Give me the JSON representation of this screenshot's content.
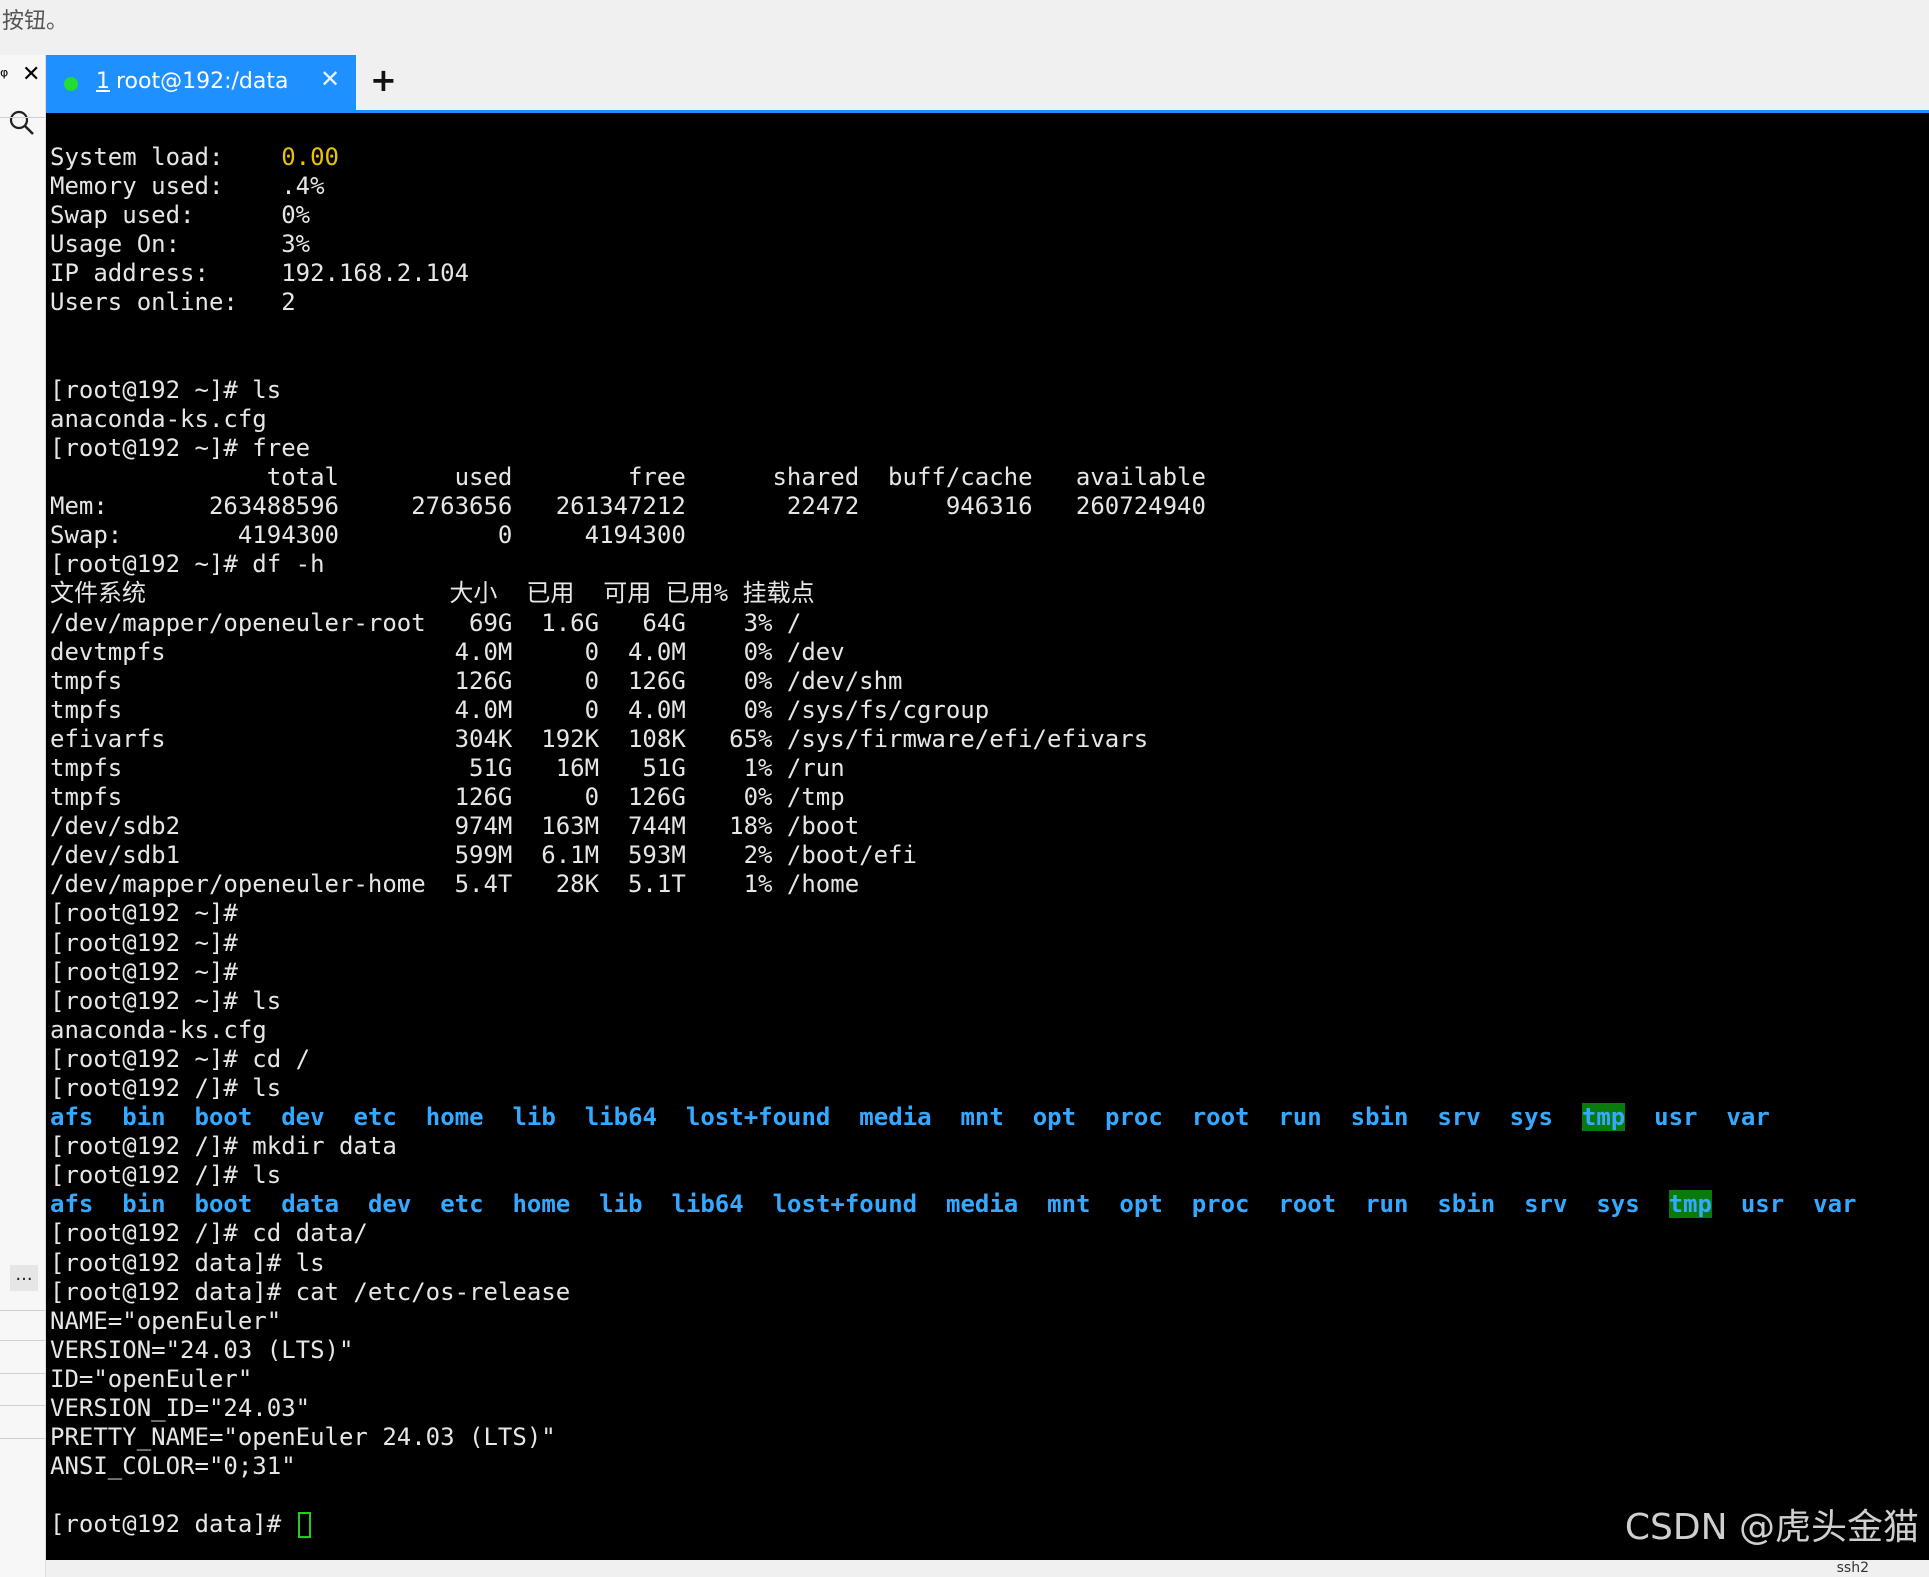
{
  "top_note": "按钮。",
  "sidebar": {
    "pin_glyph": "ᵠ",
    "close_glyph": "✕",
    "more_label": "..."
  },
  "tabbar": {
    "tab_number": "1",
    "tab_title": "root@192:/data",
    "tab_close": "✕",
    "new_tab": "+"
  },
  "terminal": {
    "lines": [
      {
        "type": "kv",
        "key": "System load:    ",
        "value": "0.00",
        "highlight": true
      },
      {
        "type": "kv",
        "key": "Memory used:    ",
        "value": ".4%"
      },
      {
        "type": "kv",
        "key": "Swap used:      ",
        "value": "0%"
      },
      {
        "type": "kv",
        "key": "Usage On:       ",
        "value": "3%"
      },
      {
        "type": "kv",
        "key": "IP address:     ",
        "value": "192.168.2.104"
      },
      {
        "type": "kv",
        "key": "Users online:   ",
        "value": "2"
      },
      {
        "type": "text",
        "text": ""
      },
      {
        "type": "text",
        "text": ""
      },
      {
        "type": "text",
        "text": "[root@192 ~]# ls"
      },
      {
        "type": "text",
        "text": "anaconda-ks.cfg"
      },
      {
        "type": "text",
        "text": "[root@192 ~]# free"
      },
      {
        "type": "text",
        "text": "               total        used        free      shared  buff/cache   available"
      },
      {
        "type": "text",
        "text": "Mem:       263488596     2763656   261347212       22472      946316   260724940"
      },
      {
        "type": "text",
        "text": "Swap:        4194300           0     4194300"
      },
      {
        "type": "text",
        "text": "[root@192 ~]# df -h"
      },
      {
        "type": "text",
        "text": "文件系统                     大小  已用  可用 已用% 挂载点"
      },
      {
        "type": "text",
        "text": "/dev/mapper/openeuler-root   69G  1.6G   64G    3% /"
      },
      {
        "type": "text",
        "text": "devtmpfs                    4.0M     0  4.0M    0% /dev"
      },
      {
        "type": "text",
        "text": "tmpfs                       126G     0  126G    0% /dev/shm"
      },
      {
        "type": "text",
        "text": "tmpfs                       4.0M     0  4.0M    0% /sys/fs/cgroup"
      },
      {
        "type": "text",
        "text": "efivarfs                    304K  192K  108K   65% /sys/firmware/efi/efivars"
      },
      {
        "type": "text",
        "text": "tmpfs                        51G   16M   51G    1% /run"
      },
      {
        "type": "text",
        "text": "tmpfs                       126G     0  126G    0% /tmp"
      },
      {
        "type": "text",
        "text": "/dev/sdb2                   974M  163M  744M   18% /boot"
      },
      {
        "type": "text",
        "text": "/dev/sdb1                   599M  6.1M  593M    2% /boot/efi"
      },
      {
        "type": "text",
        "text": "/dev/mapper/openeuler-home  5.4T   28K  5.1T    1% /home"
      },
      {
        "type": "text",
        "text": "[root@192 ~]#"
      },
      {
        "type": "text",
        "text": "[root@192 ~]#"
      },
      {
        "type": "text",
        "text": "[root@192 ~]#"
      },
      {
        "type": "text",
        "text": "[root@192 ~]# ls"
      },
      {
        "type": "text",
        "text": "anaconda-ks.cfg"
      },
      {
        "type": "text",
        "text": "[root@192 ~]# cd /"
      },
      {
        "type": "text",
        "text": "[root@192 /]# ls"
      },
      {
        "type": "ls",
        "items": [
          "afs",
          "bin",
          "boot",
          "dev",
          "etc",
          "home",
          "lib",
          "lib64",
          "lost+found",
          "media",
          "mnt",
          "opt",
          "proc",
          "root",
          "run",
          "sbin",
          "srv",
          "sys",
          "tmp",
          "usr",
          "var"
        ]
      },
      {
        "type": "text",
        "text": "[root@192 /]# mkdir data"
      },
      {
        "type": "text",
        "text": "[root@192 /]# ls"
      },
      {
        "type": "ls",
        "items": [
          "afs",
          "bin",
          "boot",
          "data",
          "dev",
          "etc",
          "home",
          "lib",
          "lib64",
          "lost+found",
          "media",
          "mnt",
          "opt",
          "proc",
          "root",
          "run",
          "sbin",
          "srv",
          "sys",
          "tmp",
          "usr",
          "var"
        ]
      },
      {
        "type": "text",
        "text": "[root@192 /]# cd data/"
      },
      {
        "type": "text",
        "text": "[root@192 data]# ls"
      },
      {
        "type": "text",
        "text": "[root@192 data]# cat /etc/os-release"
      },
      {
        "type": "text",
        "text": "NAME=\"openEuler\""
      },
      {
        "type": "text",
        "text": "VERSION=\"24.03 (LTS)\""
      },
      {
        "type": "text",
        "text": "ID=\"openEuler\""
      },
      {
        "type": "text",
        "text": "VERSION_ID=\"24.03\""
      },
      {
        "type": "text",
        "text": "PRETTY_NAME=\"openEuler 24.03 (LTS)\""
      },
      {
        "type": "text",
        "text": "ANSI_COLOR=\"0;31\""
      },
      {
        "type": "text",
        "text": ""
      },
      {
        "type": "prompt",
        "text": "[root@192 data]# "
      }
    ],
    "colors": {
      "background": "#000000",
      "text": "#e6e6e6",
      "directory": "#35a8ff",
      "highlight_value": "#e8c400",
      "tmp_background": "#0a7a0a",
      "cursor": "#22cc22"
    }
  },
  "watermark": "CSDN @虎头金猫",
  "bottom_hint": "ssh2"
}
